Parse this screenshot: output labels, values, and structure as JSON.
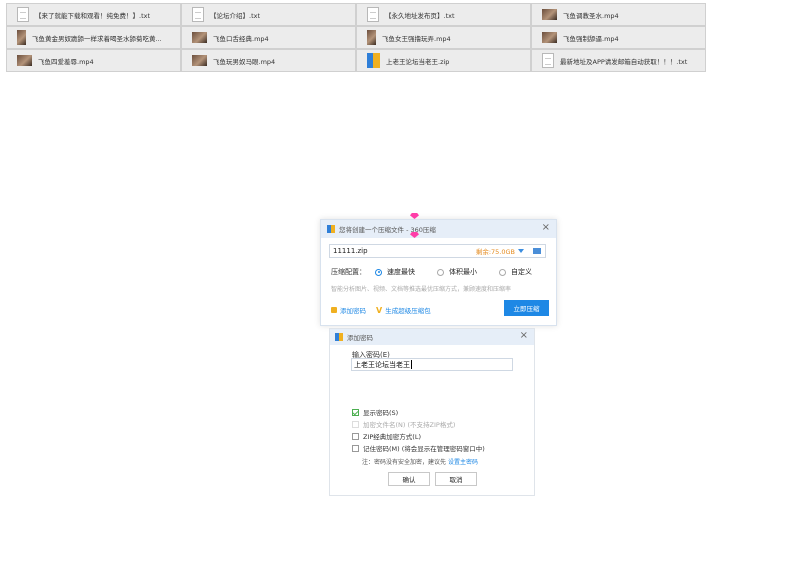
{
  "files": [
    {
      "name": "【来了就能下载和观看！纯免费！】.txt",
      "icon": "txt-file-icon"
    },
    {
      "name": "【论坛介绍】.txt",
      "icon": "txt-file-icon"
    },
    {
      "name": "【永久地址发布页】.txt",
      "icon": "txt-file-icon"
    },
    {
      "name": "飞鱼调教圣水.mp4",
      "icon": "video-thumb-icon"
    },
    {
      "name": "飞鱼黄金男奴跪舔一样求着喝圣水舔菊吃黄...",
      "icon": "video-thumb-icon"
    },
    {
      "name": "飞鱼口舌经典.mp4",
      "icon": "video-thumb-icon"
    },
    {
      "name": "飞鱼女王强撸玩弄.mp4",
      "icon": "video-thumb-icon"
    },
    {
      "name": "飞鱼强制舔逼.mp4",
      "icon": "video-thumb-icon"
    },
    {
      "name": "飞鱼四爱羞辱.mp4",
      "icon": "video-thumb-icon"
    },
    {
      "name": "飞鱼玩男奴马眼.mp4",
      "icon": "video-thumb-icon"
    },
    {
      "name": "上老王论坛当老王.zip",
      "icon": "zip-archive-icon"
    },
    {
      "name": "最新地址及APP请发邮箱自动获取！！！.txt",
      "icon": "txt-file-icon"
    }
  ],
  "compress_dialog": {
    "title": "您将创建一个压缩文件 - 360压缩",
    "filename": "11111.zip",
    "free_space": "剩余:75.0GB",
    "config_label": "压缩配置：",
    "options": [
      "速度最快",
      "体积最小",
      "自定义"
    ],
    "selected_option": "速度最快",
    "hint": "智能分析图片、视频、文档等推选最优压缩方式，兼顾速度和压缩率",
    "add_password": "添加密码",
    "super_package": "生成超级压缩包",
    "start_button": "立即压缩"
  },
  "password_dialog": {
    "title": "添加密码",
    "input_label": "输入密码(E)",
    "password_value": "上老王论坛当老王",
    "show_password": "显示密码(S)",
    "encrypt_filename": "加密文件名(N) (不支持ZIP格式)",
    "zip_classic": "ZIP经典加密方式(L)",
    "remember_password": "记住密码(M) (将会显示在管理密码窗口中)",
    "note_prefix": "注：密码没有安全加密，建议先",
    "note_link": "设置主密码",
    "ok_button": "确认",
    "cancel_button": "取消"
  },
  "colors": {
    "accent": "#1e88e5",
    "warning": "#e48a1d",
    "titlebar": "#e6eef8"
  }
}
